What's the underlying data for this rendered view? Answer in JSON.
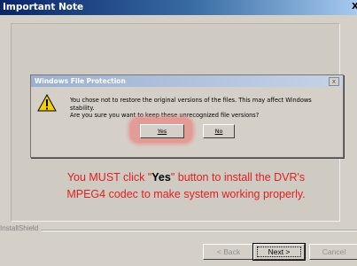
{
  "window": {
    "title": "Important Note",
    "close_glyph": "X"
  },
  "dialog": {
    "title": "Windows File Protection",
    "close_glyph": "x",
    "message_line1": "You chose not to restore the original versions of the files.  This may affect Windows stability.",
    "message_line2": "Are you sure you want to keep these unrecognized file versions?",
    "yes_label": "Yes",
    "no_label": "No",
    "icon": "warning-icon"
  },
  "note": {
    "part1": "You MUST click \"",
    "yes_word": "Yes",
    "part2": "\" button to install the DVR's",
    "line2": "MPEG4 codec to make system working properly."
  },
  "footer": {
    "brand": "InstallShield",
    "back_label": "< Back",
    "next_label": "Next >",
    "cancel_label": "Cancel"
  },
  "colors": {
    "note_red": "#e02020",
    "highlight": "#e98a86",
    "titlebar": "#0a246a"
  }
}
